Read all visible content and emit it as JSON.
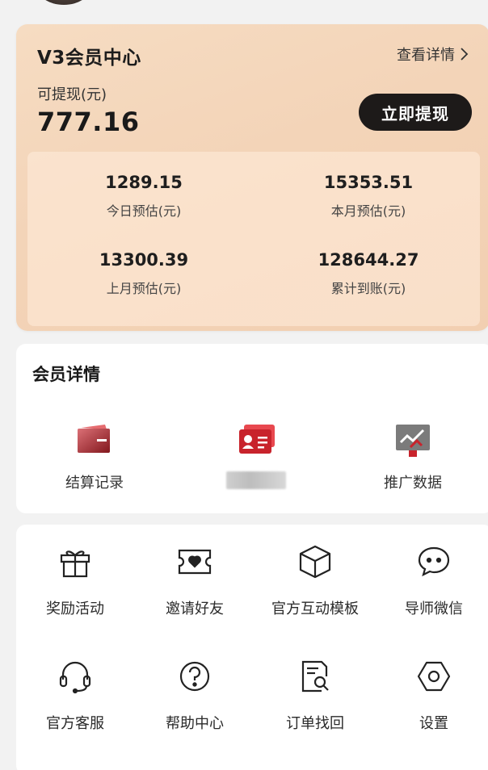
{
  "vip": {
    "title": "V3会员中心",
    "detail_link": "查看详情",
    "withdrawable_label": "可提现(元)",
    "withdrawable_amount": "777.16",
    "withdraw_button": "立即提现",
    "stats": [
      {
        "value": "1289.15",
        "label": "今日预估(元)"
      },
      {
        "value": "15353.51",
        "label": "本月预估(元)"
      },
      {
        "value": "13300.39",
        "label": "上月预估(元)"
      },
      {
        "value": "128644.27",
        "label": "累计到账(元)"
      }
    ]
  },
  "member": {
    "title": "会员详情",
    "items": [
      {
        "label": "结算记录",
        "icon": "wallet-icon"
      },
      {
        "label": "",
        "icon": "id-card-icon"
      },
      {
        "label": "推广数据",
        "icon": "trend-chart-icon"
      }
    ]
  },
  "tools": [
    {
      "label": "奖励活动",
      "icon": "gift-icon"
    },
    {
      "label": "邀请好友",
      "icon": "ticket-heart-icon"
    },
    {
      "label": "官方互动模板",
      "icon": "cube-icon"
    },
    {
      "label": "导师微信",
      "icon": "chat-bubble-icon"
    },
    {
      "label": "官方客服",
      "icon": "headset-icon"
    },
    {
      "label": "帮助中心",
      "icon": "question-icon"
    },
    {
      "label": "订单找回",
      "icon": "document-search-icon"
    },
    {
      "label": "设置",
      "icon": "settings-hex-icon"
    }
  ],
  "colors": {
    "vip_card_bg": "#f4d6ba",
    "withdraw_button_bg": "#1d1a19",
    "icon_red": "#c8232c"
  }
}
